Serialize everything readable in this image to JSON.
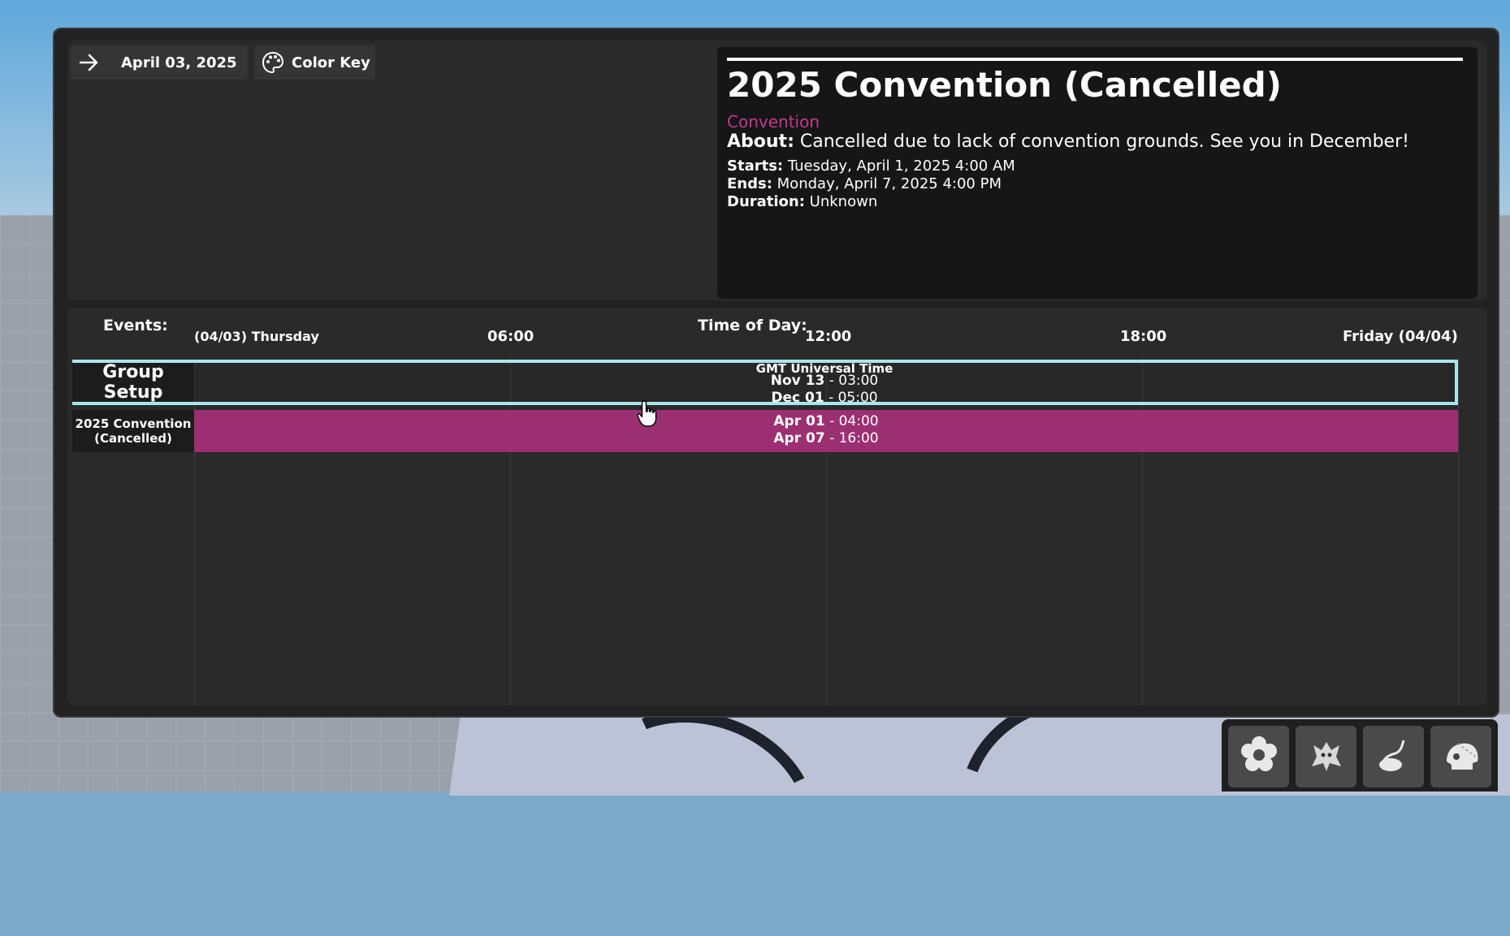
{
  "toolbar_top": {
    "date_label": "April 03, 2025",
    "color_key_label": "Color Key"
  },
  "details": {
    "title": "2025 Convention (Cancelled)",
    "category": "Convention",
    "about_label": "About:",
    "about_text": "Cancelled due to lack of convention grounds. See you in December!",
    "starts_label": "Starts:",
    "starts_text": "Tuesday, April 1, 2025 4:00 AM",
    "ends_label": "Ends:",
    "ends_text": "Monday, April 7, 2025 4:00 PM",
    "duration_label": "Duration:",
    "duration_text": "Unknown",
    "category_color": "#c33a8e"
  },
  "timeline": {
    "events_label": "Events:",
    "time_of_day_label": "Time of Day:",
    "start_day": "(04/03) Thursday",
    "tick_06": "06:00",
    "tick_12": "12:00",
    "tick_18": "18:00",
    "end_day": "Friday (04/04)",
    "rows": [
      {
        "name": "Group Setup",
        "timezone": "GMT Universal Time",
        "start_date": "Nov 13",
        "start_time": " - 03:00",
        "end_date": "Dec 01",
        "end_time": " - 05:00",
        "border_color": "#a8e6ec"
      },
      {
        "name": "2025 Convention (Cancelled)",
        "start_date": "Apr 01",
        "start_time": " - 04:00",
        "end_date": "Apr 07",
        "end_time": " - 16:00",
        "bar_color": "#9c2f72"
      }
    ]
  },
  "tools": [
    "flower-icon",
    "creature-icon",
    "tail-icon",
    "skull-icon"
  ]
}
